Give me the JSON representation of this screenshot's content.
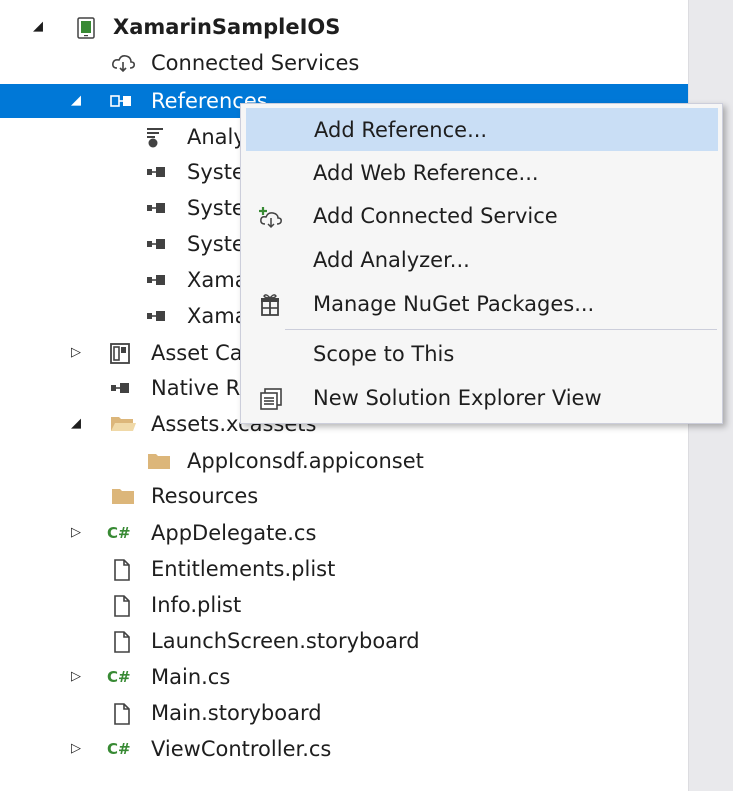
{
  "tree": {
    "project": "XamarinSampleIOS",
    "connected_services": "Connected Services",
    "references": "References",
    "ref_items": [
      "Analy",
      "Syste",
      "Syste",
      "Syste",
      "Xama",
      "Xama"
    ],
    "asset_catalog": "Asset Ca",
    "native_refs": "Native R",
    "assets": "Assets.xcassets",
    "appicons": "AppIconsdf.appiconset",
    "resources": "Resources",
    "app_delegate": "AppDelegate.cs",
    "entitlements": "Entitlements.plist",
    "info": "Info.plist",
    "launch": "LaunchScreen.storyboard",
    "main_cs": "Main.cs",
    "main_sb": "Main.storyboard",
    "view_controller": "ViewController.cs"
  },
  "menu": {
    "add_reference": "Add Reference...",
    "add_web_reference": "Add Web Reference...",
    "add_connected_service": "Add Connected Service",
    "add_analyzer": "Add Analyzer...",
    "manage_nuget": "Manage NuGet Packages...",
    "scope_to_this": "Scope to This",
    "new_solution_view": "New Solution Explorer View"
  },
  "icons": {
    "expanded": "expanded-triangle-icon",
    "collapsed": "collapsed-triangle-icon",
    "cs_label": "C#"
  },
  "colors": {
    "selection": "#0078d7",
    "menu_hover": "#c9def5",
    "folder": "#dcb67a",
    "csharp": "#388a34"
  }
}
